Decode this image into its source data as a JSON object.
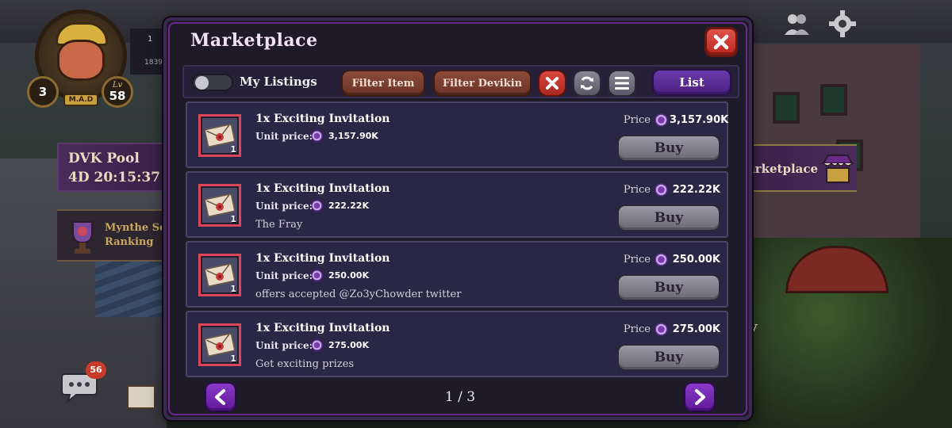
{
  "colors": {
    "modal_bg": "#1e1a28",
    "listing_bg": "#2a2646",
    "accent_purple": "#6a3aa8",
    "close_red": "#d8483e",
    "buy_grey": "#8a8896",
    "filter_brown": "#8a4a3a"
  },
  "hud": {
    "player_level": "3",
    "lv_label": "Lv",
    "lv_value": "58",
    "mad_badge": "M.A.D",
    "top_number_partial": "1",
    "xp_partial": "1839",
    "dvk_pool_title": "DVK Pool",
    "dvk_pool_timer": "4D 20:15:37",
    "ranking_line1": "Mynthe Se",
    "ranking_line2": "Ranking",
    "chat_count": "56",
    "marketplace_label_partial": "arketplace",
    "bg_text_fragment": "y"
  },
  "modal": {
    "title": "Marketplace",
    "close_icon": "close-x-icon"
  },
  "toolbar": {
    "my_listings_label": "My Listings",
    "my_listings_on": false,
    "filter_item_label": "Filter Item",
    "filter_devikin_label": "Filter Devikin",
    "clear_icon": "x-icon",
    "refresh_icon": "refresh-icon",
    "sort_icon": "hamburger-icon",
    "list_label": "List"
  },
  "listings": [
    {
      "icon": "envelope-icon",
      "quantity_badge": "1",
      "name": "1x Exciting Invitation",
      "unit_label": "Unit price:",
      "unit_price": "3,157.90K",
      "description": "",
      "price_label": "Price",
      "price": "3,157.90K",
      "buy_label": "Buy"
    },
    {
      "icon": "envelope-icon",
      "quantity_badge": "1",
      "name": "1x Exciting Invitation",
      "unit_label": "Unit price:",
      "unit_price": "222.22K",
      "description": "The Fray",
      "price_label": "Price",
      "price": "222.22K",
      "buy_label": "Buy"
    },
    {
      "icon": "envelope-icon",
      "quantity_badge": "1",
      "name": "1x Exciting Invitation",
      "unit_label": "Unit price:",
      "unit_price": "250.00K",
      "description": "offers accepted @Zo3yChowder twitter",
      "price_label": "Price",
      "price": "250.00K",
      "buy_label": "Buy"
    },
    {
      "icon": "envelope-icon",
      "quantity_badge": "1",
      "name": "1x Exciting Invitation",
      "unit_label": "Unit price:",
      "unit_price": "275.00K",
      "description": "Get exciting prizes",
      "price_label": "Price",
      "price": "275.00K",
      "buy_label": "Buy"
    }
  ],
  "pager": {
    "current_page": 1,
    "total_pages": 3,
    "page_text": "1 / 3",
    "prev_icon": "chevron-left-icon",
    "next_icon": "chevron-right-icon"
  }
}
